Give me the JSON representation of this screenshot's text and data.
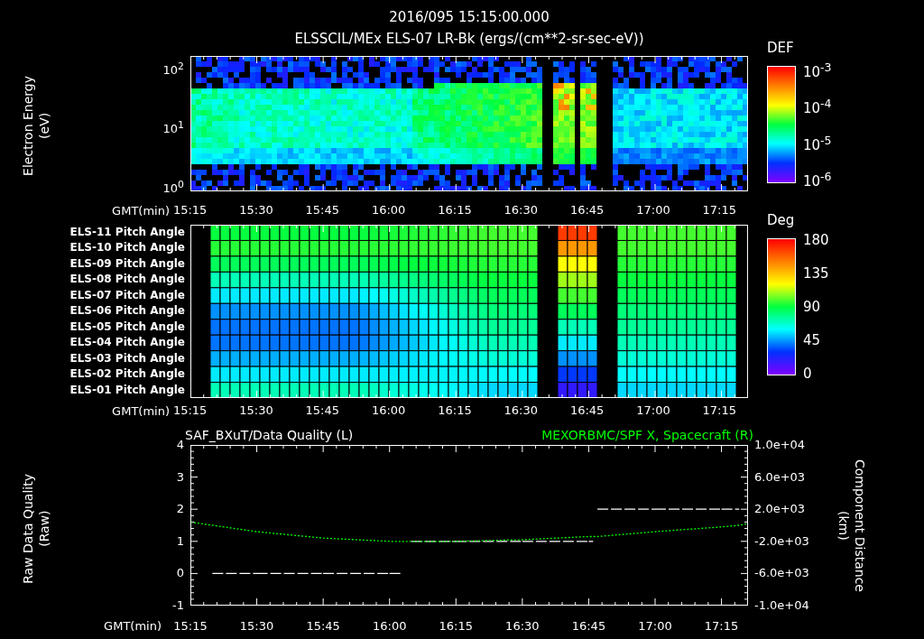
{
  "header": {
    "date_time": "2016/095 15:15:00.000",
    "title": "ELSSCIL/MEx ELS-07 LR-Bk (ergs/(cm**2-sr-sec-eV))"
  },
  "spectrogram": {
    "ylabel": [
      "Electron Energy",
      "(eV)"
    ],
    "yticks": [
      "10$^{2}$",
      "10$^{1}$",
      "10$^{0}$"
    ],
    "xlabel": "GMT(min)",
    "xticks": [
      "15:15",
      "15:30",
      "15:45",
      "16:00",
      "16:15",
      "16:30",
      "16:45",
      "17:00",
      "17:15"
    ],
    "colorbar": {
      "title": "DEF",
      "ticks": [
        "10$^{-3}$",
        "10$^{-4}$",
        "10$^{-5}$",
        "10$^{-6}$"
      ]
    }
  },
  "pitch_angles": {
    "rows": [
      "ELS-11 Pitch Angle",
      "ELS-10 Pitch Angle",
      "ELS-09 Pitch Angle",
      "ELS-08 Pitch Angle",
      "ELS-07 Pitch Angle",
      "ELS-06 Pitch Angle",
      "ELS-05 Pitch Angle",
      "ELS-04 Pitch Angle",
      "ELS-03 Pitch Angle",
      "ELS-02 Pitch Angle",
      "ELS-01 Pitch Angle"
    ],
    "xlabel": "GMT(min)",
    "xticks": [
      "15:15",
      "15:30",
      "15:45",
      "16:00",
      "16:15",
      "16:30",
      "16:45",
      "17:00",
      "17:15"
    ],
    "colorbar": {
      "title": "Deg",
      "ticks": [
        "180",
        "135",
        "90",
        "45",
        "0"
      ]
    }
  },
  "line_panel": {
    "ylabel": [
      "Raw Data Quality",
      "(Raw)"
    ],
    "right_axis": {
      "label": [
        "Component Distance",
        "(km)"
      ],
      "ticks": [
        "1.0e+04",
        "6.0e+03",
        "2.0e+03",
        "-2.0e+03",
        "-6.0e+03",
        "-1.0e+04"
      ]
    },
    "chart_data": {
      "type": "line",
      "xlabel": "GMT(min)",
      "x": [
        15.25,
        15.333,
        15.5,
        15.75,
        16,
        16.05,
        16.083,
        16.25,
        16.5,
        16.75,
        16.767,
        16.783,
        17,
        17.25,
        17.317,
        17.35
      ],
      "xlim": [
        15.25,
        17.35
      ],
      "xticks": [
        {
          "value": 15.25,
          "label": "15:15"
        },
        {
          "value": 15.5,
          "label": "15:30"
        },
        {
          "value": 15.75,
          "label": "15:45"
        },
        {
          "value": 16,
          "label": "16:00"
        },
        {
          "value": 16.25,
          "label": "16:15"
        },
        {
          "value": 16.5,
          "label": "16:30"
        },
        {
          "value": 16.75,
          "label": "16:45"
        },
        {
          "value": 17,
          "label": "17:00"
        },
        {
          "value": 17.25,
          "label": "17:15"
        }
      ],
      "ylim": [
        -1,
        4
      ],
      "yticks": [
        4,
        3,
        2,
        1,
        0,
        -1
      ],
      "series": [
        {
          "name": "SAF_BXuT/Data Quality (L)",
          "color": "#ffffff",
          "line_style": "dashed",
          "values": [
            null,
            0,
            0,
            0,
            0,
            0,
            1,
            1,
            1,
            1,
            1,
            2,
            2,
            2,
            2,
            null
          ]
        },
        {
          "name": "MEXORBMC/SPF X, Spacecraft (R)",
          "color": "#00ff00",
          "line_style": "dotted",
          "values": [
            1.6,
            1.5,
            1.3,
            1.1,
            1.0,
            1.0,
            1.0,
            1.0,
            1.05,
            1.15,
            1.15,
            1.15,
            1.3,
            1.45,
            1.5,
            1.55
          ]
        }
      ]
    }
  }
}
